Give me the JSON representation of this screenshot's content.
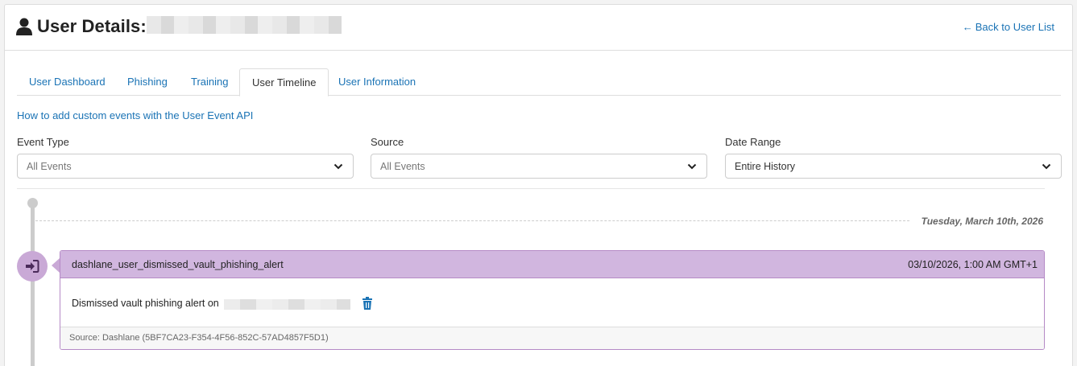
{
  "header": {
    "title": "User Details:",
    "back_link": "Back to User List",
    "back_icon": "arrow-left-icon",
    "user_icon": "user-icon"
  },
  "tabs": [
    {
      "label": "User Dashboard",
      "active": false
    },
    {
      "label": "Phishing",
      "active": false
    },
    {
      "label": "Training",
      "active": false
    },
    {
      "label": "User Timeline",
      "active": true
    },
    {
      "label": "User Information",
      "active": false
    }
  ],
  "api_link": "How to add custom events with the User Event API",
  "filters": {
    "event_type": {
      "label": "Event Type",
      "value": "All Events"
    },
    "source": {
      "label": "Source",
      "value": "All Events"
    },
    "date_range": {
      "label": "Date Range",
      "value": "Entire History"
    }
  },
  "timeline": {
    "date_label": "Tuesday, March 10th, 2026",
    "events": [
      {
        "name": "dashlane_user_dismissed_vault_phishing_alert",
        "time": "03/10/2026, 1:00 AM GMT+1",
        "description": "Dismissed vault phishing alert on",
        "source": "Source: Dashlane (5BF7CA23-F354-4F56-852C-57AD4857F5D1)",
        "icon": "sign-in-icon",
        "accent_color": "#d1b6df"
      }
    ]
  },
  "colors": {
    "link": "#1a73b5",
    "event_header": "#d1b6df",
    "event_border": "#b58ac6"
  }
}
